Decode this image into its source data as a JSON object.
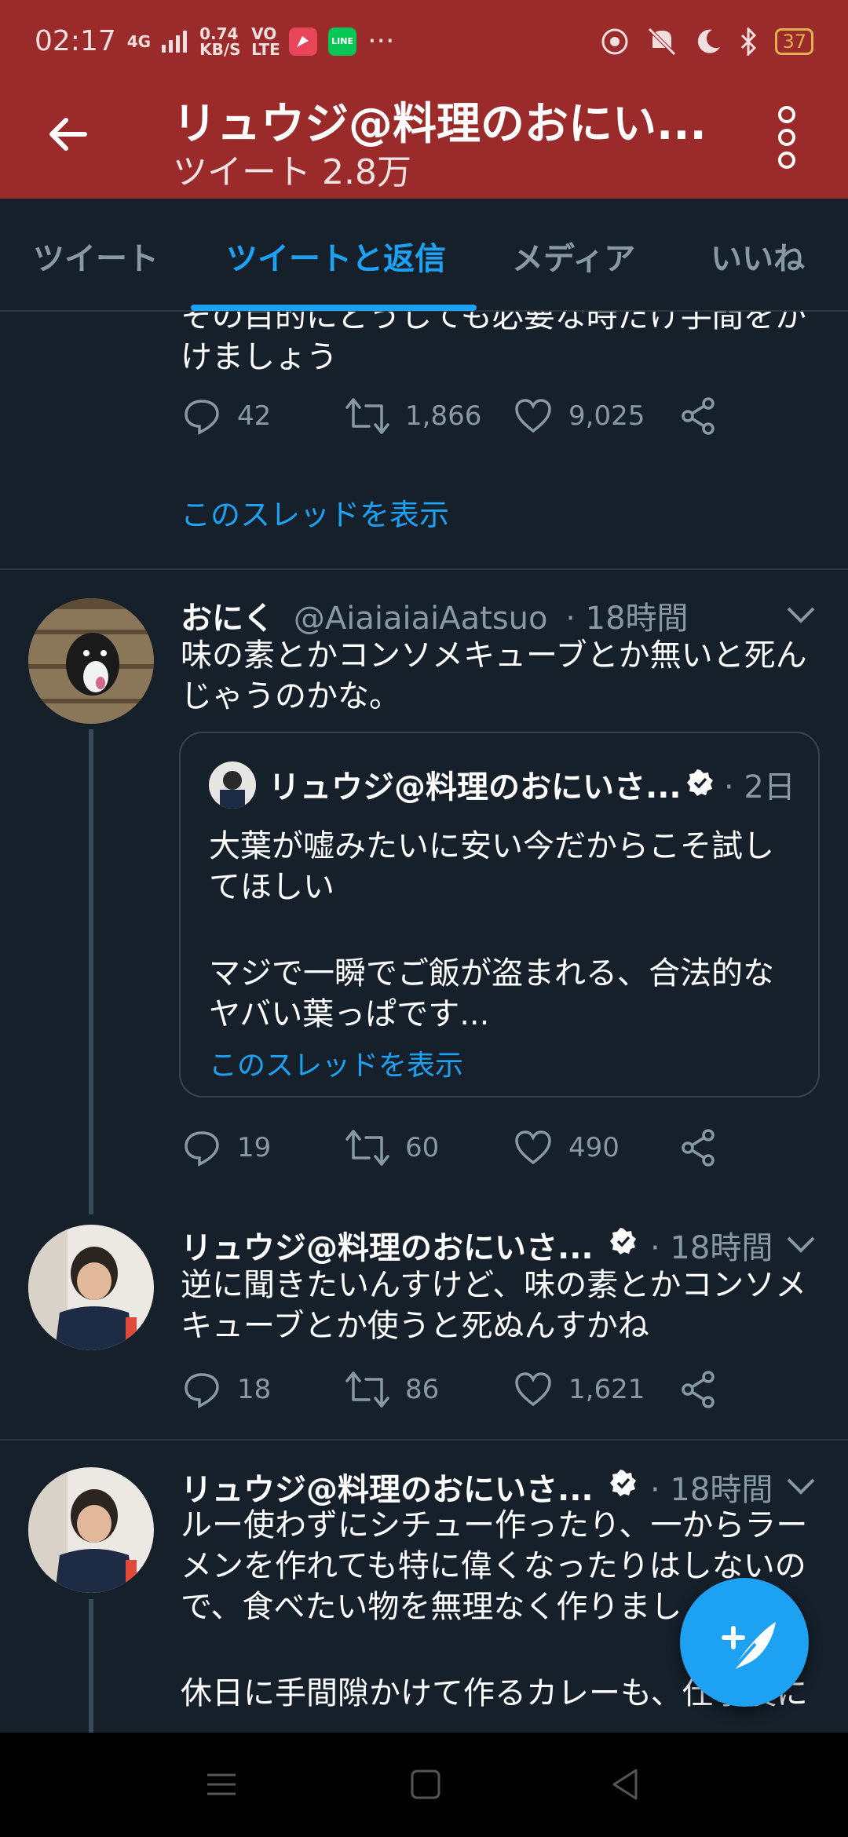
{
  "status_bar": {
    "time": "02:17",
    "network": "4G",
    "speed": "0.74 KB/S",
    "volte": "VO LTE",
    "overflow": "···",
    "battery": "37",
    "line_icon_label": "LINE"
  },
  "header": {
    "title": "リュウジ@料理のおにい...",
    "subtitle": "ツイート 2.8万"
  },
  "tabs": [
    {
      "label": "ツイート",
      "active": false
    },
    {
      "label": "ツイートと返信",
      "active": true
    },
    {
      "label": "メディア",
      "active": false
    },
    {
      "label": "いいね",
      "active": false
    }
  ],
  "feed": {
    "tweet0": {
      "text_line1": "その目的にどうしても必要な時だけ手間をか",
      "text_line2": "けましょう",
      "replies": "42",
      "retweets": "1,866",
      "likes": "9,025",
      "show_thread": "このスレッドを表示"
    },
    "tweet1": {
      "name": "おにく",
      "handle": "@AiaiaiaiAatsuo",
      "time": "· 18時間",
      "text": "味の素とかコンソメキューブとか無いと死ん\nじゃうのかな。",
      "quote": {
        "name": "リュウジ@料理のおにいさ...",
        "time": "· 2日",
        "text1": "大葉が嘘みたいに安い今だからこそ試し\nてほしい",
        "text2": "マジで一瞬でご飯が盗まれる、合法的な\nヤバい葉っぱです...",
        "show_thread": "このスレッドを表示"
      },
      "replies": "19",
      "retweets": "60",
      "likes": "490"
    },
    "tweet2": {
      "name": "リュウジ@料理のおにいさ...",
      "time": "· 18時間",
      "text": "逆に聞きたいんすけど、味の素とかコンソメ\nキューブとか使うと死ぬんすかね",
      "replies": "18",
      "retweets": "86",
      "likes": "1,621"
    },
    "tweet3": {
      "name": "リュウジ@料理のおにいさ...",
      "time": "· 18時間",
      "text": "ルー使わずにシチュー作ったり、一からラー\nメンを作れても特に偉くなったりはしないの\nで、食べたい物を無理なく作りまし",
      "text2": "休日に手間隙かけて作るカレーも、仕事後に"
    }
  },
  "colors": {
    "header_bg": "#9b2b2a",
    "bg": "#15202b",
    "accent": "#1da1f2",
    "muted": "#8899a6"
  }
}
